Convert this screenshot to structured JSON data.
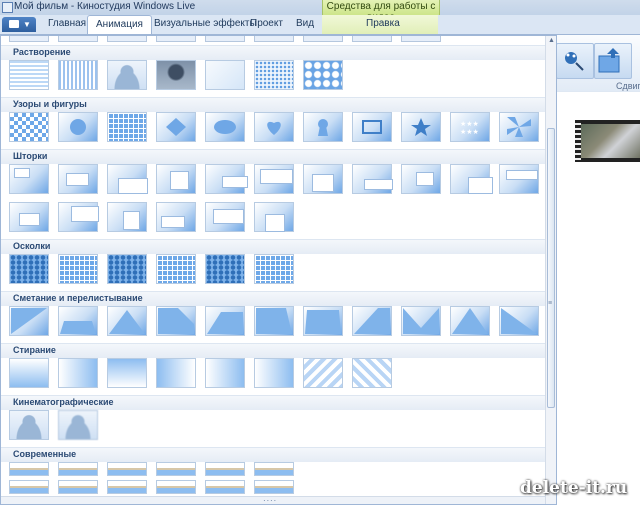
{
  "window": {
    "title": "Мой фильм - Киностудия Windows Live"
  },
  "context_group": {
    "label": "Средства для работы с видео"
  },
  "tabs": [
    {
      "label": "Главная",
      "active": false
    },
    {
      "label": "Анимация",
      "active": true
    },
    {
      "label": "Визуальные эффекты",
      "active": false
    },
    {
      "label": "Проект",
      "active": false
    },
    {
      "label": "Вид",
      "active": false
    },
    {
      "label": "Правка",
      "active": false,
      "contextual": true
    }
  ],
  "ribbon": {
    "group_label_partial": "Сдвиг"
  },
  "gallery": {
    "categories": [
      {
        "label": "Растворение",
        "count": 7
      },
      {
        "label": "Узоры и фигуры",
        "count": 11
      },
      {
        "label": "Шторки",
        "count": 17
      },
      {
        "label": "Осколки",
        "count": 6
      },
      {
        "label": "Сметание и перелистывание",
        "count": 11
      },
      {
        "label": "Стирание",
        "count": 8
      },
      {
        "label": "Кинематографические",
        "count": 2
      },
      {
        "label": "Современные",
        "count": 6
      }
    ]
  },
  "watermark": "delete-it.ru",
  "colors": {
    "accent": "#4f83c6",
    "context_tab": "#cde58a",
    "thumb_blue": "#6fa7e6"
  }
}
